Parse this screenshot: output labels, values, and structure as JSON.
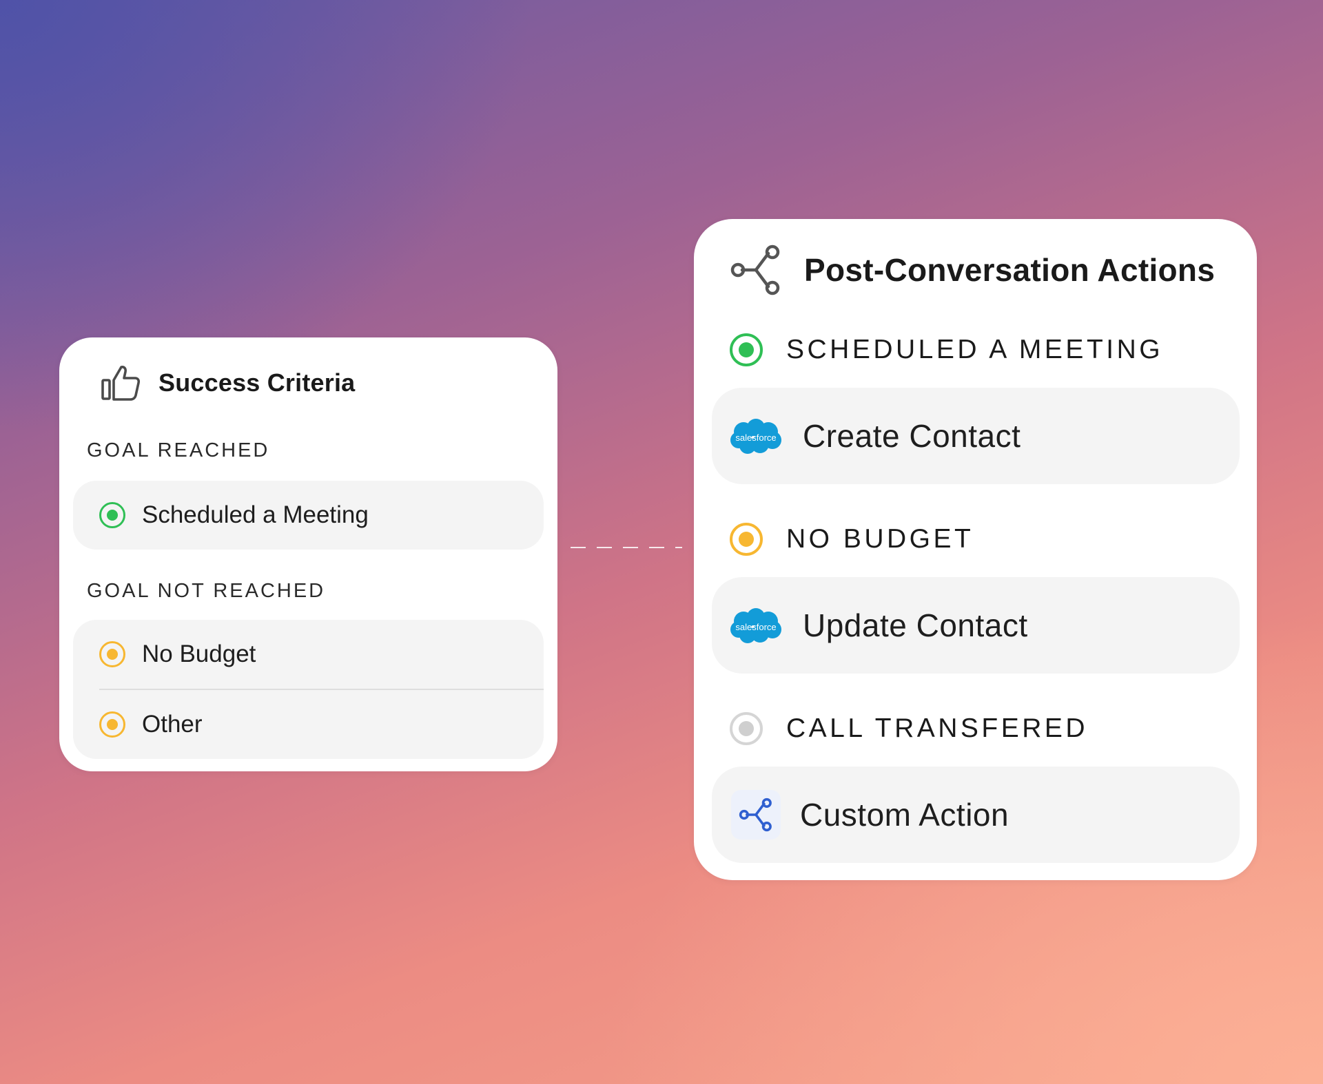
{
  "success_criteria": {
    "title": "Success Criteria",
    "icon": "thumbs-up-icon",
    "goal_reached": {
      "label": "GOAL REACHED",
      "items": [
        {
          "label": "Scheduled a Meeting",
          "status": "green"
        }
      ]
    },
    "goal_not_reached": {
      "label": "GOAL NOT REACHED",
      "items": [
        {
          "label": "No Budget",
          "status": "yellow"
        },
        {
          "label": "Other",
          "status": "yellow"
        }
      ]
    }
  },
  "post_conversation": {
    "title": "Post-Conversation Actions",
    "icon": "share-nodes-icon",
    "sections": [
      {
        "label": "SCHEDULED A MEETING",
        "status": "green",
        "action": {
          "label": "Create Contact",
          "logo": "salesforce"
        }
      },
      {
        "label": "NO BUDGET",
        "status": "yellow",
        "action": {
          "label": "Update Contact",
          "logo": "salesforce"
        }
      },
      {
        "label": "CALL TRANSFERED",
        "status": "grey",
        "action": {
          "label": "Custom Action",
          "logo": "custom-action-icon"
        }
      }
    ]
  },
  "logos": {
    "salesforce_text": "salesforce"
  },
  "colors": {
    "status_green": "#2fbf55",
    "status_yellow": "#f7b731",
    "status_grey": "#cfcfcf",
    "salesforce_blue": "#139cd8",
    "custom_action_blue": "#2f5fd0"
  }
}
